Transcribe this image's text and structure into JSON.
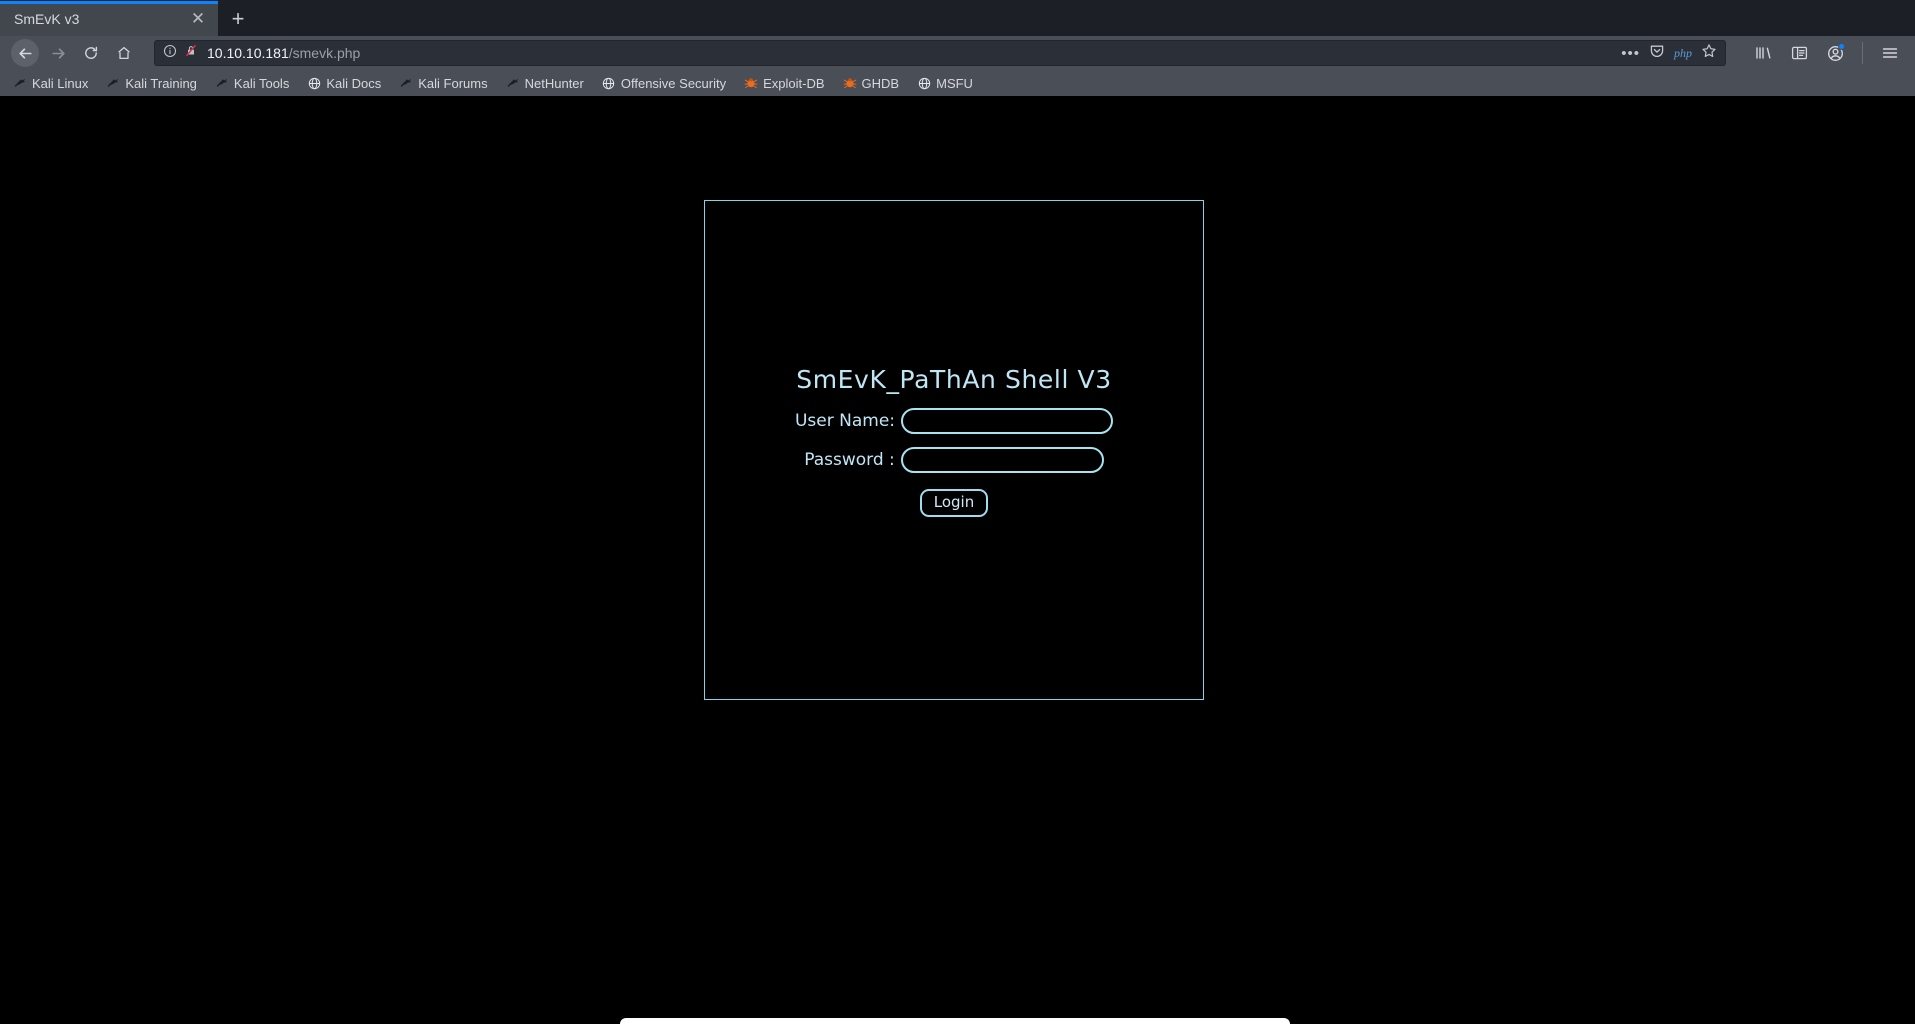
{
  "browser": {
    "tab": {
      "title": "SmEvK v3",
      "close_label": "✕",
      "newtab_label": "+"
    },
    "nav": {
      "back": "back-arrow",
      "forward": "forward-arrow",
      "reload": "reload",
      "home": "home"
    },
    "urlbar": {
      "info_icon": "info-circle-icon",
      "insecure_icon": "broken-padlock-icon",
      "host": "10.10.10.181",
      "path": "/smevk.php",
      "dots": "•••",
      "pocket_icon": "pocket-icon",
      "php_badge": "php",
      "star_icon": "star-icon"
    },
    "toolbar_right": {
      "library": "library-icon",
      "sidebar": "sidebar-icon",
      "account": "account-icon",
      "menu": "hamburger-menu-icon"
    },
    "bookmarks": [
      {
        "label": "Kali Linux",
        "icon": "kali-dragon-icon"
      },
      {
        "label": "Kali Training",
        "icon": "kali-dragon-icon"
      },
      {
        "label": "Kali Tools",
        "icon": "kali-dragon-icon"
      },
      {
        "label": "Kali Docs",
        "icon": "globe-icon"
      },
      {
        "label": "Kali Forums",
        "icon": "kali-dragon-icon"
      },
      {
        "label": "NetHunter",
        "icon": "kali-dragon-icon"
      },
      {
        "label": "Offensive Security",
        "icon": "globe-icon"
      },
      {
        "label": "Exploit-DB",
        "icon": "bug-icon"
      },
      {
        "label": "GHDB",
        "icon": "bug-icon"
      },
      {
        "label": "MSFU",
        "icon": "globe-icon"
      }
    ]
  },
  "page": {
    "title": "SmEvK_PaThAn Shell V3",
    "username": {
      "label": "User Name:",
      "value": "",
      "placeholder": ""
    },
    "password": {
      "label": "Password :",
      "value": "",
      "placeholder": ""
    },
    "login_button": "Login"
  },
  "colors": {
    "accent_cyan": "#a8e3f2",
    "title_cyan": "#bfe6f5",
    "page_background": "#000000",
    "chrome_toolbar": "#4a4e56",
    "tab_active": "#42464d",
    "tab_highlight": "#0a84ff",
    "banner_teal": "#2c6d8c"
  }
}
